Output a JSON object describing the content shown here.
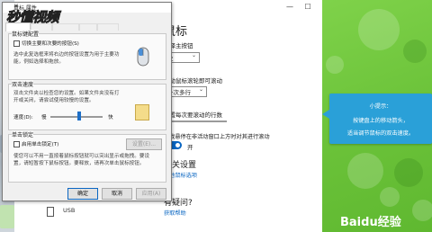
{
  "dialog": {
    "title": "鼠标 属性",
    "watermark": "秒懂视频",
    "button_swap": {
      "group_label": "鼠标键配置",
      "checkbox_label": "切换主要和次要的按钮(S)",
      "description": "选中此复选框来将右边的按钮设置为用于主要功能，例如选择和拖放。"
    },
    "double_click": {
      "group_label": "双击速度",
      "description": "双击文件夹以检查您的设置。如果文件夹没有打开或关闭，请尝试使用较慢的设置。",
      "speed_label": "速度(D):",
      "slow_label": "慢",
      "fast_label": "快"
    },
    "click_lock": {
      "group_label": "单击锁定",
      "checkbox_label": "启用单击锁定(T)",
      "settings_button": "设置(E)...",
      "description": "使您可以不用一直按着鼠标按钮就可以突出显示或拖拽。要设置，请短暂按下鼠标按钮。要释放，请再次单击鼠标按钮。"
    },
    "buttons": {
      "ok": "确定",
      "cancel": "取消",
      "apply": "应用(A)"
    }
  },
  "settings": {
    "heading": "鼠标",
    "primary_button_label": "选择主按钮",
    "primary_button_value": "左",
    "scroll_label": "滚动鼠标滚轮即可滚动",
    "scroll_value": "一次多行",
    "lines_label": "设置每次要滚动的行数",
    "inactive_scroll_label": "当我悬停在非活动窗口上方时对其进行滚动",
    "toggle_state": "开",
    "related_heading": "相关设置",
    "other_mouse_options": "其他鼠标选项",
    "question_heading": "有疑问?",
    "get_help": "获取帮助"
  },
  "bottom_strip": {
    "usb_label": "USB"
  },
  "tip": {
    "title": "小提示：",
    "line1": "按键盘上的移动箭头，",
    "line2": "适当调节鼠标的双击速度。"
  },
  "brand": {
    "baidu": "Baidu经验"
  },
  "colors": {
    "accent_blue": "#0a66c2",
    "tip_blue": "#2aa0d8",
    "green": "#6cc33a"
  }
}
